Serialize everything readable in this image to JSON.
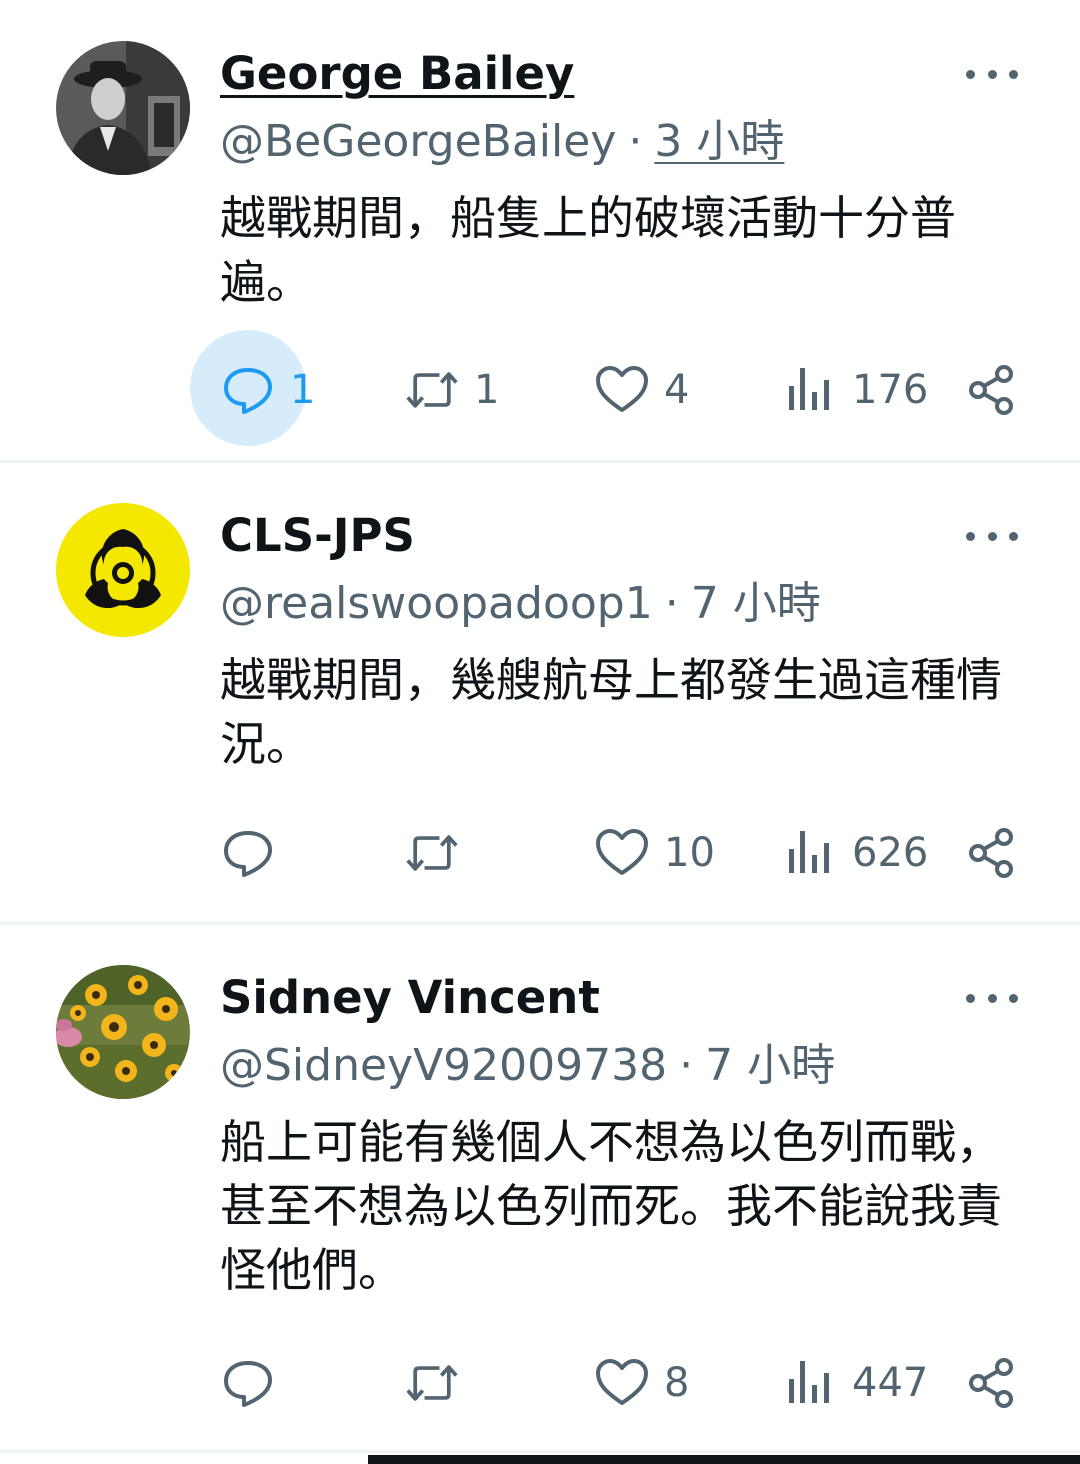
{
  "tweets": [
    {
      "name": "George Bailey",
      "handle": "@BeGeorgeBailey",
      "separator": "·",
      "time": "3 小時",
      "text": "越戰期間，船隻上的破壞活動十分普遍。",
      "replies": "1",
      "retweets": "1",
      "likes": "4",
      "views": "176",
      "avatar_icon": "portrait-photo-icon"
    },
    {
      "name": "CLS-JPS",
      "handle": "@realswoopadoop1",
      "separator": "·",
      "time": "7 小時",
      "text": "越戰期間，幾艘航母上都發生過這種情況。",
      "replies": "",
      "retweets": "",
      "likes": "10",
      "views": "626",
      "avatar_icon": "biohazard-icon"
    },
    {
      "name": "Sidney Vincent",
      "handle": "@SidneyV92009738",
      "separator": "·",
      "time": "7 小時",
      "text": "船上可能有幾個人不想為以色列而戰，甚至不想為以色列而死。我不能說我責怪他們。",
      "replies": "",
      "retweets": "",
      "likes": "8",
      "views": "447",
      "avatar_icon": "flowers-photo-icon"
    }
  ],
  "colors": {
    "text": "#0f1419",
    "secondary": "#536471",
    "accent": "#1d9bf0",
    "divider": "#eff3f4"
  }
}
